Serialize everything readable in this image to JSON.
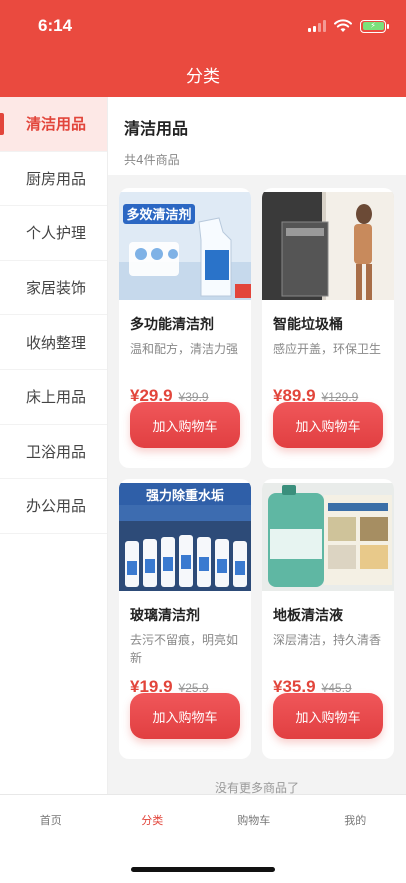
{
  "status_bar": {
    "time": "6:14"
  },
  "header": {
    "title": "分类"
  },
  "sidebar": {
    "items": [
      {
        "label": "清洁用品"
      },
      {
        "label": "厨房用品"
      },
      {
        "label": "个人护理"
      },
      {
        "label": "家居装饰"
      },
      {
        "label": "收纳整理"
      },
      {
        "label": "床上用品"
      },
      {
        "label": "卫浴用品"
      },
      {
        "label": "办公用品"
      }
    ],
    "active_index": 0
  },
  "category": {
    "title": "清洁用品",
    "count": "共4件商品"
  },
  "products": [
    {
      "name": "多功能清洁剂",
      "desc": "温和配方，清洁力强",
      "price": "¥29.9",
      "old_price": "¥39.9",
      "button": "加入购物车",
      "image_text": "多效清洁剂"
    },
    {
      "name": "智能垃圾桶",
      "desc": "感应开盖，环保卫生",
      "price": "¥89.9",
      "old_price": "¥129.9",
      "button": "加入购物车",
      "image_text": ""
    },
    {
      "name": "玻璃清洁剂",
      "desc": "去污不留痕，明亮如新",
      "price": "¥19.9",
      "old_price": "¥25.9",
      "button": "加入购物车",
      "image_text": "强力除重水垢"
    },
    {
      "name": "地板清洁液",
      "desc": "深层清洁，持久清香",
      "price": "¥35.9",
      "old_price": "¥45.9",
      "button": "加入购物车",
      "image_text": ""
    }
  ],
  "footer_note": "没有更多商品了",
  "tabbar": {
    "items": [
      {
        "label": "首页"
      },
      {
        "label": "分类"
      },
      {
        "label": "购物车"
      },
      {
        "label": "我的"
      }
    ],
    "active_index": 1
  },
  "colors": {
    "brand": "#ea4a3f",
    "accent": "#e2453b"
  }
}
